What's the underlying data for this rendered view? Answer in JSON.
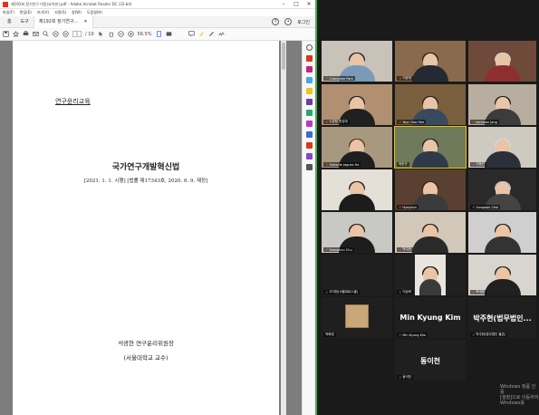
{
  "acrobat": {
    "title": "제192회 정기연구 미팅(요약본).pdf - Adobe Acrobat Reader DC (32-bit)",
    "menu": [
      "파일(F)",
      "편집(E)",
      "보기(V)",
      "서명(S)",
      "창(W)",
      "도움말(H)"
    ],
    "tabs": {
      "home": "홈",
      "tools": "도구",
      "document": "제192회 정기연구..."
    },
    "login": "로그인",
    "toolbar": {
      "page_current": "1",
      "page_total": "/ 10",
      "zoom": "56.5%"
    },
    "page": {
      "category": "연구윤리교육",
      "law_title": "국가연구개발혁신법",
      "law_sub": "[2021. 1. 1. 시행] [법률 제17343호, 2020. 6. 9. 제정]",
      "author": "석광현 연구윤리위원장",
      "affiliation": "(서울대학교 교수)"
    }
  },
  "zoom": {
    "participants": [
      {
        "name": "Changhee Park",
        "type": "video",
        "active": false
      },
      {
        "name": "이윤재",
        "type": "video",
        "active": false
      },
      {
        "name": "",
        "type": "video",
        "active": false
      },
      {
        "name": "노한정 한성대",
        "type": "video",
        "active": false
      },
      {
        "name": "Youn Soo Hee",
        "type": "video",
        "active": false
      },
      {
        "name": "Jaehwan Jang",
        "type": "video",
        "active": false
      },
      {
        "name": "Stefanie Jagues Ha",
        "type": "video",
        "active": false
      },
      {
        "name": "최준규",
        "type": "video",
        "active": true
      },
      {
        "name": "이동진",
        "type": "video",
        "active": false
      },
      {
        "name": "",
        "type": "video",
        "active": false
      },
      {
        "name": "Hyeyeon",
        "type": "video",
        "active": false
      },
      {
        "name": "Sangwon Choi",
        "type": "video",
        "active": false
      },
      {
        "name": "Seongkun Chu",
        "type": "video",
        "active": false
      },
      {
        "name": "박주현",
        "type": "video",
        "active": false
      },
      {
        "name": "",
        "type": "video",
        "active": false
      },
      {
        "name": "오지현(서울대로스쿨)",
        "type": "video",
        "active": false
      },
      {
        "name": "이승혁",
        "type": "video",
        "active": false
      },
      {
        "name": "박세림",
        "type": "video",
        "active": false
      },
      {
        "name": "곽희정",
        "type": "image",
        "active": false
      },
      {
        "name": "Min Kyung Kim",
        "type": "name",
        "display": "Min Kyung Kim",
        "active": false
      },
      {
        "name": "박주현(법무법인 율촌)",
        "type": "name",
        "display": "박주현(법무법인...",
        "active": false
      },
      {
        "name": "동이천",
        "type": "name",
        "display": "동이천",
        "active": false
      }
    ],
    "watermark_line1": "Windows 정품 인증",
    "watermark_line2": "[설정]으로 이동하여 Windows를"
  },
  "colors": {
    "accent_green": "#3cb34a",
    "active_speaker": "#f2c200",
    "mic_muted": "#ff4b4b"
  }
}
